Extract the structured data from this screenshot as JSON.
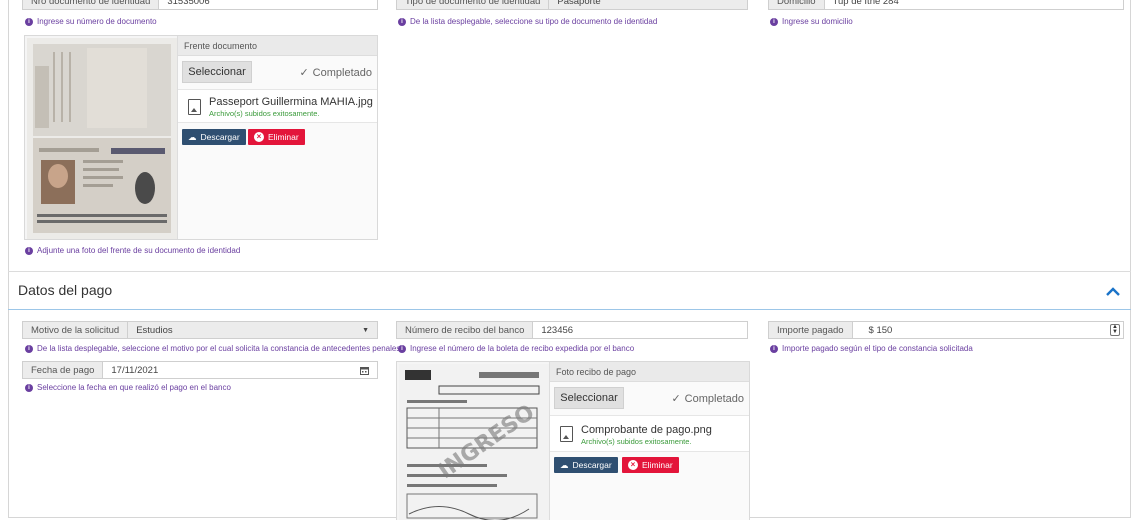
{
  "top": {
    "doc_number": {
      "label": "Nro documento de identidad",
      "value": "31535006",
      "hint": "Ingrese su número de documento"
    },
    "doc_type": {
      "label": "Tipo de documento de identidad",
      "value": "Pasaporte",
      "hint": "De la lista desplegable, seleccione su tipo de documento de identidad"
    },
    "address": {
      "label": "Domicilio",
      "value": "Tup de Ithe 284",
      "hint": "Ingrese su domicilio"
    }
  },
  "front_upload": {
    "title": "Frente documento",
    "select_label": "Seleccionar",
    "status_label": "Completado",
    "file_name": "Passeport Guillermina MAHIA.jpg",
    "file_status": "Archivo(s) subidos exitosamente.",
    "download_label": "Descargar",
    "delete_label": "Eliminar",
    "hint": "Adjunte una foto del frente de su documento de identidad"
  },
  "payment": {
    "section_title": "Datos del pago",
    "reason": {
      "label": "Motivo de la solicitud",
      "value": "Estudios",
      "hint": "De la lista desplegable, seleccione el motivo por el cual solicita la constancia de antecedentes penales"
    },
    "receipt_number": {
      "label": "Número de recibo del banco",
      "value": "123456",
      "hint": "Ingrese el número de la boleta de recibo expedida por el banco"
    },
    "amount": {
      "label": "Importe pagado",
      "value": "$ 150",
      "hint": "Importe pagado según el tipo de constancia solicitada"
    },
    "date": {
      "label": "Fecha de pago",
      "value": "17/11/2021",
      "hint": "Seleccione la fecha en que realizó el pago en el banco"
    },
    "receipt_upload": {
      "title": "Foto recibo de pago",
      "select_label": "Seleccionar",
      "status_label": "Completado",
      "file_name": "Comprobante de pago.png",
      "file_status": "Archivo(s) subidos exitosamente.",
      "download_label": "Descargar",
      "delete_label": "Eliminar"
    }
  },
  "colors": {
    "accent": "#6a3fa0",
    "download": "#2f4f71",
    "delete": "#e3153a",
    "success": "#3a9a3a",
    "link": "#1a73c8"
  }
}
